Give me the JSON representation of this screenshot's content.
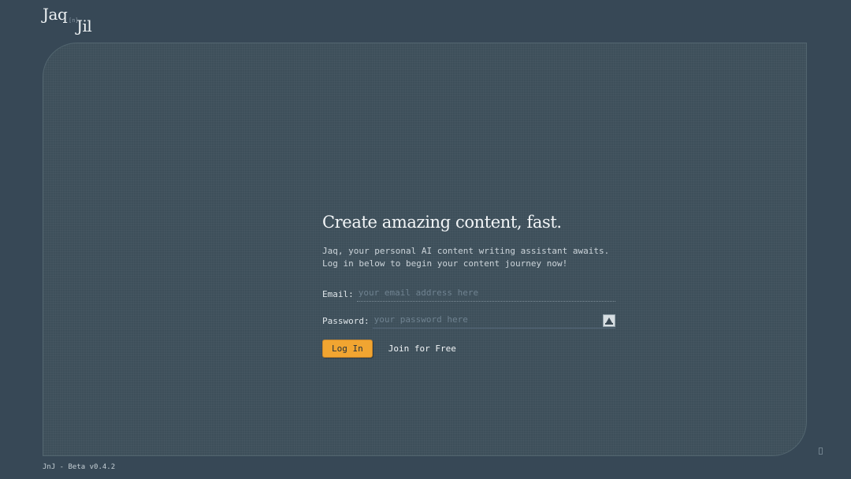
{
  "brand": {
    "word1": "Jaq",
    "connector": "[n]",
    "word2": "Jil"
  },
  "hero": {
    "headline": "Create amazing content, fast.",
    "subline1": "Jaq, your personal AI content writing assistant awaits.",
    "subline2": "Log in below to begin your content journey now!"
  },
  "form": {
    "email_label": "Email:",
    "email_placeholder": "your email address here",
    "password_label": "Password:",
    "password_placeholder": "your password here",
    "login_label": "Log In",
    "join_label": "Join for Free"
  },
  "footer": {
    "version": "JnJ - Beta v0.4.2"
  },
  "colors": {
    "background": "#374856",
    "accent": "#f1a531"
  },
  "icons": {
    "password_toggle": "show-password-icon",
    "corner": "corner-icon"
  }
}
